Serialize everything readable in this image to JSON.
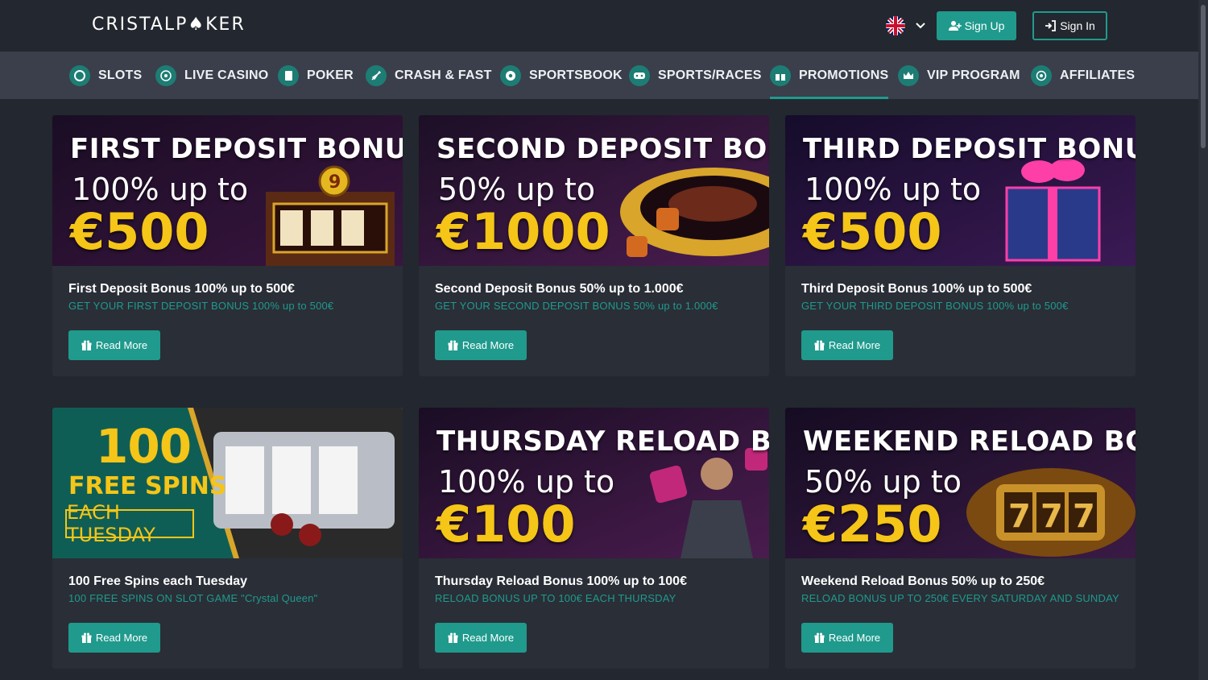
{
  "header": {
    "logo": "CRISTALP♠KER",
    "signup_label": "Sign Up",
    "signin_label": "Sign In"
  },
  "nav": {
    "items": [
      {
        "label": "SLOTS",
        "icon": "slots-icon"
      },
      {
        "label": "LIVE CASINO",
        "icon": "live-casino-icon"
      },
      {
        "label": "POKER",
        "icon": "poker-icon"
      },
      {
        "label": "CRASH & FAST",
        "icon": "rocket-icon"
      },
      {
        "label": "SPORTSBOOK",
        "icon": "soccer-ball-icon"
      },
      {
        "label": "SPORTS/RACES",
        "icon": "gamepad-icon"
      },
      {
        "label": "PROMOTIONS",
        "icon": "gift-icon",
        "active": true
      },
      {
        "label": "VIP PROGRAM",
        "icon": "crown-icon"
      },
      {
        "label": "AFFILIATES",
        "icon": "affiliates-icon"
      }
    ]
  },
  "colors": {
    "accent": "#1f9a8d",
    "gold": "#f5c518",
    "background": "#23272f",
    "nav": "#3a3f4b",
    "card": "#2a2e37"
  },
  "promos": [
    {
      "banner_title": "FIRST DEPOSIT BONUS",
      "banner_sub": "100% up to",
      "banner_amount": "€500",
      "title": "First Deposit Bonus 100% up to 500€",
      "subtitle": "GET YOUR FIRST DEPOSIT BONUS 100% up to 500€",
      "button": "Read More"
    },
    {
      "banner_title": "SECOND DEPOSIT BONUS",
      "banner_sub": "50% up to",
      "banner_amount": "€1000",
      "title": "Second Deposit Bonus 50% up to 1.000€",
      "subtitle": "GET YOUR SECOND DEPOSIT BONUS 50% up to 1.000€",
      "button": "Read More"
    },
    {
      "banner_title": "THIRD DEPOSIT BONUS",
      "banner_sub": "100% up to",
      "banner_amount": "€500",
      "title": "Third Deposit Bonus 100% up to 500€",
      "subtitle": "GET YOUR THIRD DEPOSIT BONUS 100% up to 500€",
      "button": "Read More"
    },
    {
      "banner_num": "100",
      "banner_spins": "FREE SPINS",
      "banner_tuesday": "EACH TUESDAY",
      "title": "100 Free Spins each Tuesday",
      "subtitle": "100 FREE SPINS ON SLOT GAME \"Crystal Queen\"",
      "button": "Read More"
    },
    {
      "banner_title": "THURSDAY RELOAD BONUS",
      "banner_sub": "100% up to",
      "banner_amount": "€100",
      "title": "Thursday Reload Bonus 100% up to 100€",
      "subtitle": "RELOAD BONUS UP TO 100€ EACH THURSDAY",
      "button": "Read More"
    },
    {
      "banner_title": "WEEKEND RELOAD BONUS",
      "banner_sub": "50% up to",
      "banner_amount": "€250",
      "title": "Weekend Reload Bonus 50% up to 250€",
      "subtitle": "RELOAD BONUS UP TO 250€ EVERY SATURDAY AND SUNDAY",
      "button": "Read More"
    }
  ]
}
